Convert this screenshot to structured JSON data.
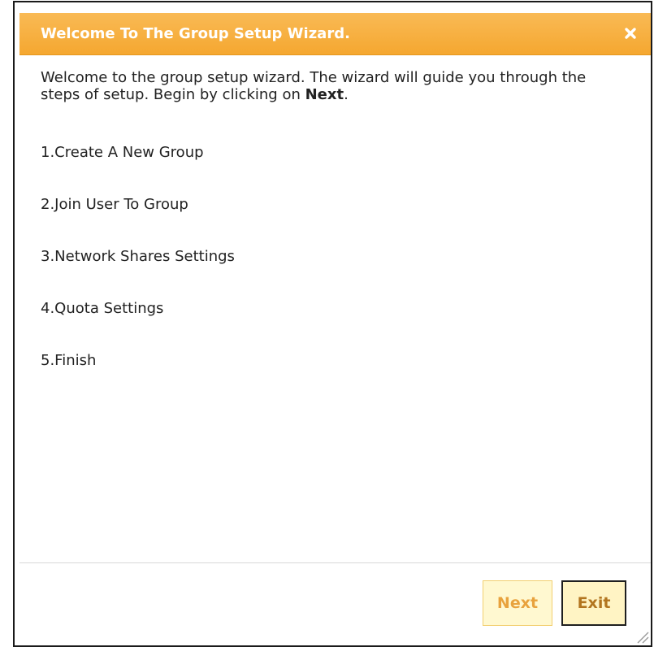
{
  "dialog": {
    "title": "Welcome To The Group Setup Wizard.",
    "close_icon": "close-icon",
    "intro_text": "Welcome to the group setup wizard. The wizard will guide you through the steps of setup. Begin by clicking on ",
    "intro_bold": "Next",
    "intro_end": ".",
    "steps": [
      "1.Create A New Group",
      "2.Join User To Group",
      "3.Network Shares Settings",
      "4.Quota Settings",
      "5.Finish"
    ],
    "buttons": {
      "next_label": "Next",
      "exit_label": "Exit"
    }
  },
  "colors": {
    "titlebar": "#f5a730",
    "title_text": "#ffffff",
    "next_text": "#e8a23d",
    "exit_text": "#b2751f",
    "button_bg": "#fff6cc"
  }
}
